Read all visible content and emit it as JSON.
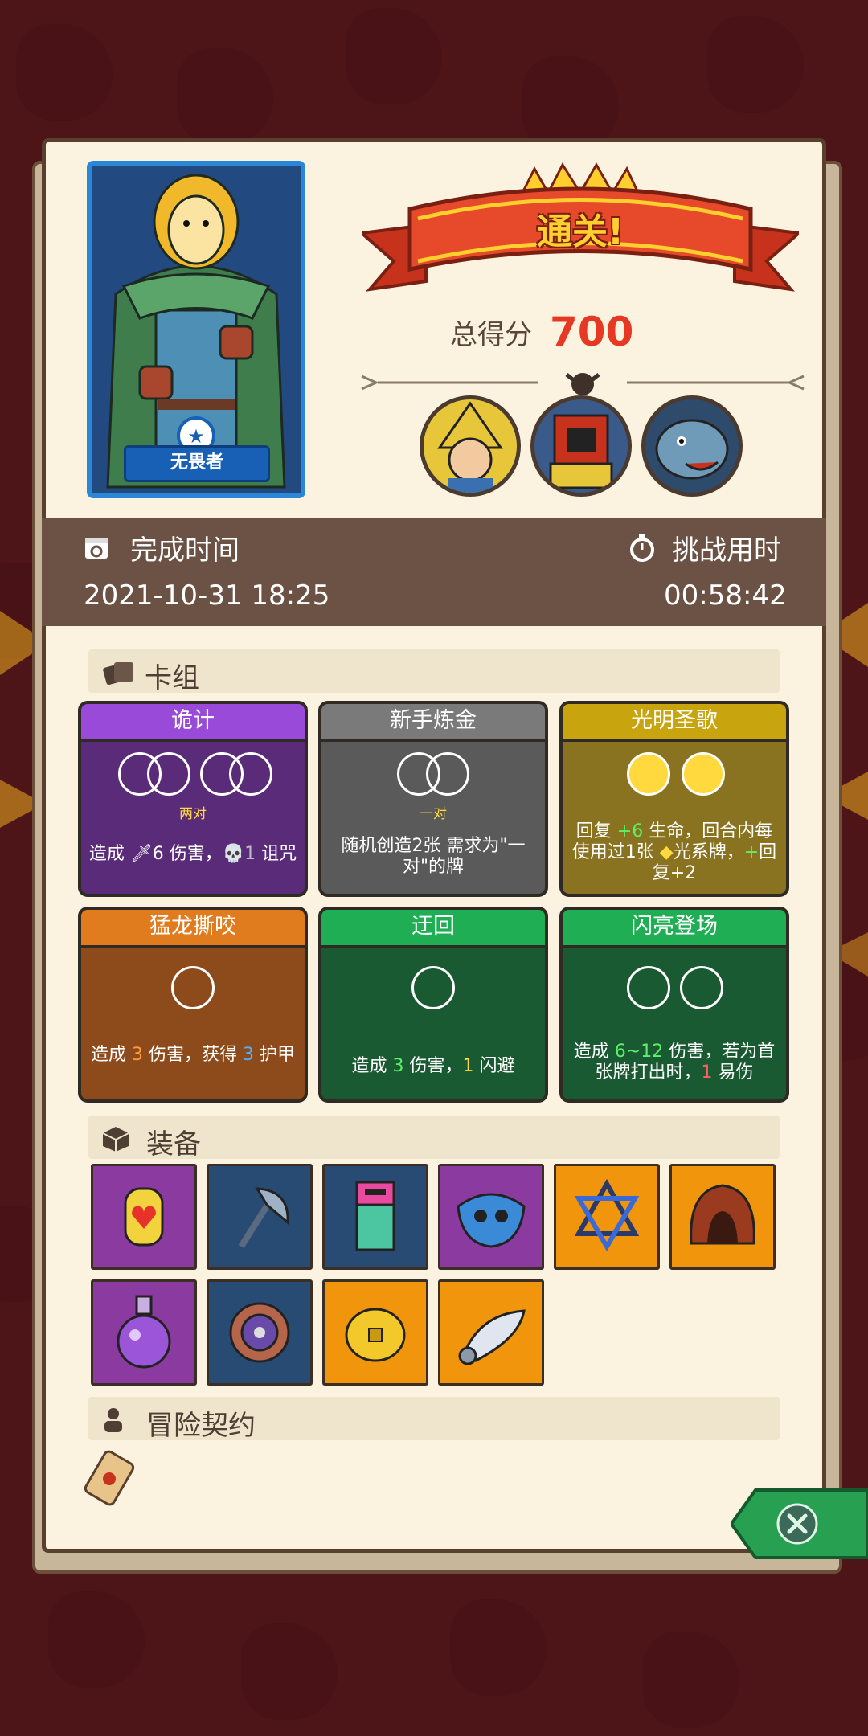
{
  "result": {
    "banner": "通关!",
    "score_label": "总得分",
    "score_value": "700"
  },
  "hero": {
    "name": "无畏者"
  },
  "bosses": [
    "wizard-boss-portrait",
    "chest-mimic-boss-portrait",
    "rhino-boss-portrait"
  ],
  "times": {
    "complete_label": "完成时间",
    "complete_value": "2021-10-31 18:25",
    "duration_label": "挑战用时",
    "duration_value": "00:58:42"
  },
  "deck": {
    "title": "卡组",
    "cards": [
      {
        "title": "诡计",
        "sub": "两对",
        "desc_parts": [
          "造成 ",
          "🗡6",
          " 伤害，",
          "💀1",
          " 诅咒"
        ],
        "color": "#9a4ad8",
        "body": "#5a2b78"
      },
      {
        "title": "新手炼金",
        "sub": "一对",
        "desc_parts": [
          "随机创造2张 需求为\"一对\"的牌"
        ],
        "color": "#7a7a7a",
        "body": "#5a5a5a"
      },
      {
        "title": "光明圣歌",
        "sub": "",
        "desc_parts": [
          "回复 ",
          "+6",
          " 生命，回合内每使用过1张 ",
          "◆",
          "光系牌，",
          "+",
          "回复+2"
        ],
        "color": "#c8a40e",
        "body": "#8a7320"
      },
      {
        "title": "猛龙撕咬",
        "sub": "",
        "desc_parts": [
          "造成 ",
          "3",
          " 伤害，获得 ",
          "3",
          " 护甲"
        ],
        "color": "#e07b1e",
        "body": "#8d4a1b"
      },
      {
        "title": "迂回",
        "sub": "",
        "desc_parts": [
          "造成 ",
          "3",
          " 伤害，",
          "1",
          " 闪避"
        ],
        "color": "#1fae54",
        "body": "#1a5a32"
      },
      {
        "title": "闪亮登场",
        "sub": "",
        "desc_parts": [
          "造成 ",
          "6~12",
          " 伤害，若为首张牌打出时，",
          "1",
          " 易伤"
        ],
        "color": "#1fae54",
        "body": "#1a5a32"
      }
    ]
  },
  "equipment": {
    "title": "装备",
    "items": [
      {
        "name": "heart-charm-icon",
        "bg": "purple"
      },
      {
        "name": "axe-icon",
        "bg": "navy"
      },
      {
        "name": "totem-icon",
        "bg": "navy"
      },
      {
        "name": "mask-icon",
        "bg": "purple"
      },
      {
        "name": "hexagram-icon",
        "bg": "orange"
      },
      {
        "name": "hood-icon",
        "bg": "orange"
      },
      {
        "name": "potion-icon",
        "bg": "purple"
      },
      {
        "name": "shield-icon",
        "bg": "navy"
      },
      {
        "name": "coin-icon",
        "bg": "orange"
      },
      {
        "name": "horn-icon",
        "bg": "orange"
      }
    ]
  },
  "contract": {
    "title": "冒险契约",
    "item": "scroll-icon"
  },
  "close_icon": "close-icon"
}
